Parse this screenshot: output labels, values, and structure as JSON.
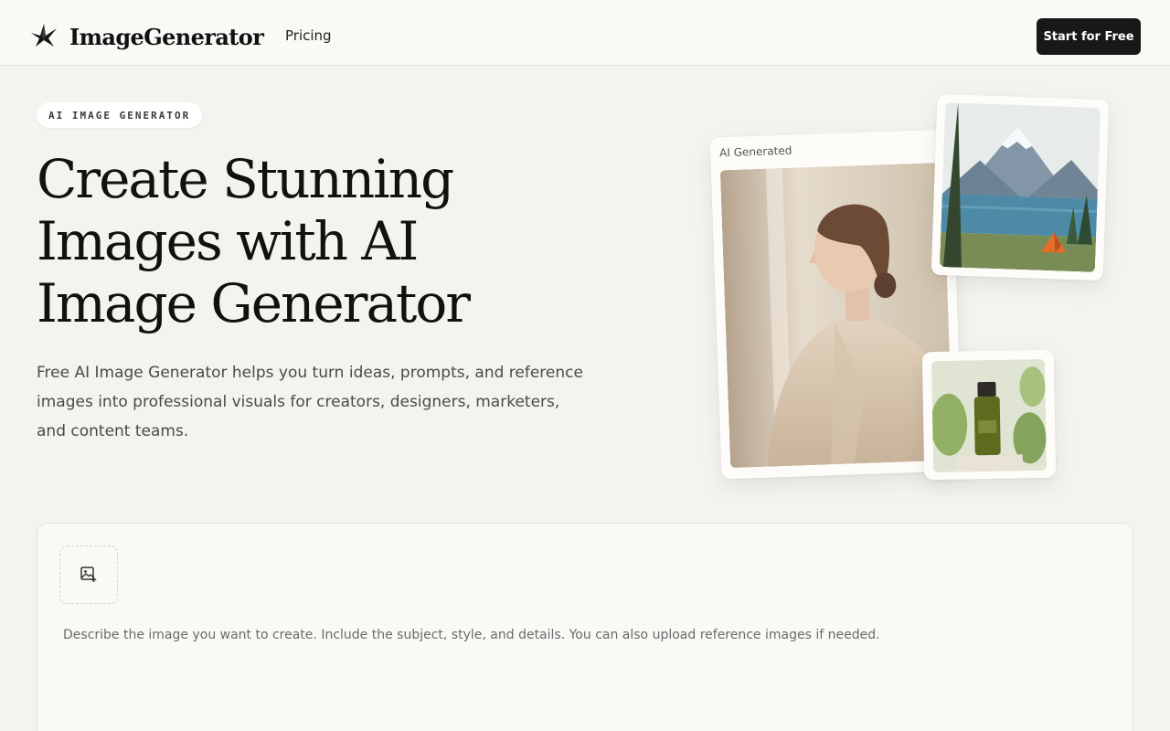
{
  "header": {
    "brand_name": "ImageGenerator",
    "logo_icon": "origami-bird-icon",
    "nav": [
      {
        "label": "Pricing"
      }
    ],
    "cta_label": "Start for Free"
  },
  "hero": {
    "badge": "AI IMAGE GENERATOR",
    "title": "Create Stunning Images with AI Image Generator",
    "description": "Free AI Image Generator helps you turn ideas, prompts, and reference images into professional visuals for creators, designers, marketers, and content teams."
  },
  "gallery": {
    "main_caption": "AI Generated"
  },
  "prompt": {
    "upload_icon": "image-plus-icon",
    "placeholder": "Describe the image you want to create. Include the subject, style, and details. You can also upload reference images if needed.",
    "value": ""
  },
  "colors": {
    "page_bg": "#f5f3ee",
    "header_bg": "#faf9f6",
    "cta_bg": "#181818",
    "text_primary": "#111111"
  }
}
